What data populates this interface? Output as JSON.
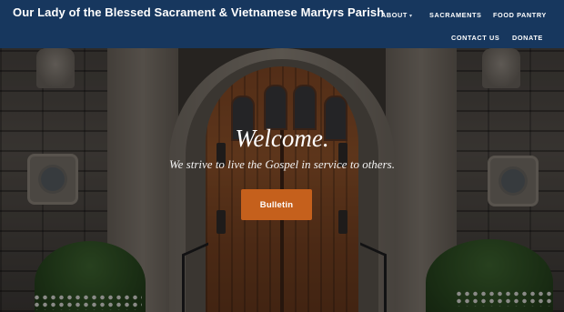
{
  "header": {
    "site_title": "Our Lady of the Blessed Sacrament & Vietnamese Martyrs Parish",
    "nav": {
      "about": "ABOUT",
      "sacraments": "SACRAMENTS",
      "food_pantry": "FOOD PANTRY",
      "contact_us": "CONTACT US",
      "donate": "DONATE"
    }
  },
  "hero": {
    "heading": "Welcome.",
    "tagline": "We strive to live the Gospel in service to others.",
    "button_label": "Bulletin"
  },
  "colors": {
    "header_bg": "#17375e",
    "button_bg": "#c5601c"
  },
  "icons": {
    "about_dropdown": "chevron-down-icon"
  }
}
